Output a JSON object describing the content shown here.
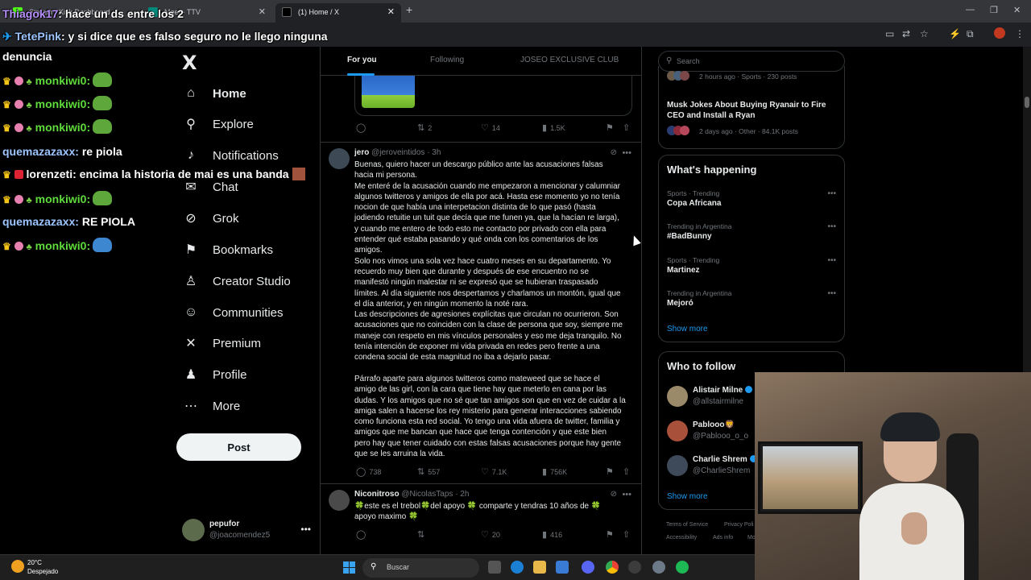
{
  "browser": {
    "tabs": [
      {
        "label": "Stream - Kick Dashboard"
      },
      {
        "label": "Meet - TTV"
      },
      {
        "label": "(1) Home / X",
        "active": true
      }
    ],
    "address_fragment": "x.com/home"
  },
  "chat": {
    "lines": [
      {
        "user": "Thiagok17",
        "msg": "hace un ds entre los 2",
        "color": "lila"
      },
      {
        "user": "TetePink",
        "msg": "y si dice que es falso seguro no le llego ninguna",
        "color": "blue"
      },
      {
        "user": "",
        "msg": "denuncia",
        "color": "white"
      },
      {
        "user": "monkiwi0:",
        "msg": "",
        "color": "green"
      },
      {
        "user": "monkiwi0:",
        "msg": "",
        "color": "green"
      },
      {
        "user": "monkiwi0:",
        "msg": "",
        "color": "green"
      },
      {
        "user": "quemazazaxx:",
        "msg": "re piola",
        "color": "blue"
      },
      {
        "user": "lorenzeti:",
        "msg": "encima la historia de mai es una banda",
        "color": "white"
      },
      {
        "user": "monkiwi0:",
        "msg": "",
        "color": "green"
      },
      {
        "user": "quemazazaxx:",
        "msg": "RE PIOLA",
        "color": "blue"
      },
      {
        "user": "monkiwi0:",
        "msg": "",
        "color": "green"
      }
    ]
  },
  "sidebar": {
    "logo": "X",
    "items": [
      {
        "label": "Home",
        "icon": "home-icon",
        "glyph": "⌂"
      },
      {
        "label": "Explore",
        "icon": "search-icon",
        "glyph": "⚲"
      },
      {
        "label": "Notifications",
        "icon": "bell-icon",
        "glyph": "♪"
      },
      {
        "label": "Chat",
        "icon": "mail-icon",
        "glyph": "✉"
      },
      {
        "label": "Grok",
        "icon": "grok-icon",
        "glyph": "⊘"
      },
      {
        "label": "Bookmarks",
        "icon": "bookmark-icon",
        "glyph": "⚑"
      },
      {
        "label": "Creator Studio",
        "icon": "creator-icon",
        "glyph": "♙"
      },
      {
        "label": "Communities",
        "icon": "communities-icon",
        "glyph": "☺"
      },
      {
        "label": "Premium",
        "icon": "x-premium-icon",
        "glyph": "✕"
      },
      {
        "label": "Profile",
        "icon": "profile-icon",
        "glyph": "♟"
      },
      {
        "label": "More",
        "icon": "more-circle-icon",
        "glyph": "⋯"
      }
    ],
    "post_label": "Post",
    "account": {
      "name": "pepufor",
      "handle": "@joacomendez5"
    }
  },
  "timeline": {
    "tabs": [
      "For you",
      "Following",
      "JOSEO EXCLUSIVE CLUB"
    ],
    "tweet0_actions": {
      "replies": "",
      "reposts": "2",
      "likes": "14",
      "views": "1.5K"
    },
    "tweet1": {
      "name": "jero",
      "handle": "@jeroveintidos",
      "time": "· 3h",
      "body": "Buenas, quiero hacer un descargo público ante las acusaciones falsas\nhacia mi persona.\nMe enteré de la acusación cuando me empezaron a mencionar y calumniar\nalgunos twitteros y amigos de ella por acá. Hasta ese momento yo no tenía\nnocion de que había una interpetacion distinta de lo que pasó (hasta\njodiendo retuitie un tuit que decía que me funen ya, que la hacían re larga),\ny cuando me entero de todo esto me contacto por privado con ella para\nentender qué estaba pasando y qué onda con los comentarios de los\namigos.\nSolo nos vimos una sola vez hace cuatro meses en su departamento. Yo\nrecuerdo muy bien que durante y después de ese encuentro no se\nmanifestó ningún malestar ni se expresó que se hubieran traspasado\nlímites. Al día siguiente nos despertamos y charlamos un montón, igual que\nel día anterior, y en ningún momento la noté rara.\nLas descripciones de agresiones explícitas que circulan no ocurrieron. Son\nacusaciones que no coinciden con la clase de persona que soy, siempre me\nmaneje con respeto en mis vínculos personales y eso me deja tranquilo. No\ntenía intención de exponer mi vida privada en redes pero frente a una\ncondena social de esta magnitud no iba a dejarlo pasar.\n\nPárrafo aparte para algunos twitteros como mateweed que se hace el\namigo de las girl, con la cara que tiene hay que meterlo en cana por las\ndudas. Y los amigos que no sé que tan amigos son que en vez de cuidar a la\namiga salen a hacerse los rey misterio para generar interacciones sabiendo\ncomo funciona esta red social. Yo tengo una vida afuera de twitter, familia y\namigos que me bancan que hace que tenga contención y que este bien\npero hay que tener cuidado con estas falsas acusaciones porque hay gente\nque se les arruina la vida.",
      "replies": "738",
      "reposts": "557",
      "likes": "7.1K",
      "views": "756K"
    },
    "tweet2": {
      "name": "Niconitroso",
      "handle": "@NicolasTaps",
      "time": "· 2h",
      "body": "🍀este es el trebol🍀del apoyo 🍀 comparte y tendras 10 años de 🍀\napoyo maximo 🍀",
      "replies": "",
      "reposts": "",
      "likes": "20",
      "views": "416"
    }
  },
  "right": {
    "search_placeholder": "Search",
    "top_trend_meta": "2 hours ago · Sports · 230 posts",
    "news_title": "Musk Jokes About Buying Ryanair to Fire CEO and Install a Ryan",
    "news_meta": "2 days ago · Other · 84.1K posts",
    "happening_title": "What's happening",
    "trends": [
      {
        "context": "Sports · Trending",
        "name": "Copa Africana"
      },
      {
        "context": "Trending in Argentina",
        "name": "#BadBunny"
      },
      {
        "context": "Sports · Trending",
        "name": "Martinez"
      },
      {
        "context": "Trending in Argentina",
        "name": "Mejoró"
      }
    ],
    "show_more": "Show more",
    "wtf_title": "Who to follow",
    "follow": [
      {
        "name": "Alistair Milne",
        "handle": "@allstairmilne",
        "verified": true
      },
      {
        "name": "Pablooo🦁",
        "handle": "@Pablooo_o_o",
        "verified": false
      },
      {
        "name": "Charlie Shrem",
        "handle": "@CharlieShrem",
        "verified": true
      }
    ],
    "footer": [
      "Terms of Service",
      "Privacy Poli",
      "Accessibility",
      "Ads info",
      "Mo"
    ]
  },
  "taskbar": {
    "temp": "20°C",
    "weather": "Despejado",
    "search": "Buscar"
  },
  "colors": {
    "accent": "#1d9bf0",
    "bg": "#000000",
    "border": "#2f3336",
    "muted": "#71767b"
  }
}
